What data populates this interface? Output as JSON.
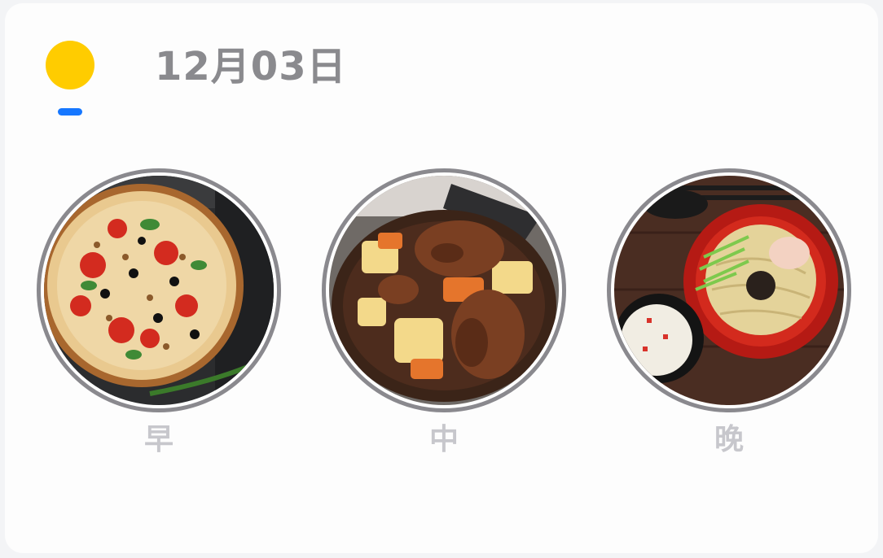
{
  "header": {
    "date": "12月03日",
    "weather_icon": "sun-icon",
    "sun_color": "#FFCC00",
    "indicator_color": "#1677FF",
    "date_color": "#8a8a8e"
  },
  "meals": [
    {
      "label": "早",
      "image": "pizza-photo"
    },
    {
      "label": "中",
      "image": "braised-chicken-potato-photo"
    },
    {
      "label": "晚",
      "image": "noodle-bowl-photo"
    }
  ],
  "label_color": "#c7c7cc"
}
